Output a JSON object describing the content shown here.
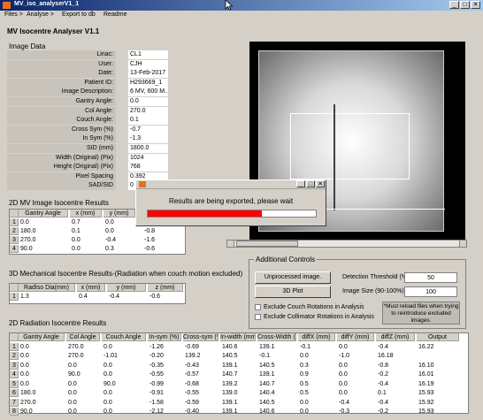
{
  "window": {
    "title": "MV_iso_analyserV1_1"
  },
  "controls": {
    "minimize": "_",
    "maximize": "□",
    "close": "✕"
  },
  "menu": [
    "Files >",
    "Analyse >",
    "Export to db",
    "Readme"
  ],
  "app_title": "MV Isocentre Analyser V1.1",
  "image_data": {
    "heading": "Image Data",
    "rows": [
      {
        "label": "Linac:",
        "value": "CL1"
      },
      {
        "label": "User:",
        "value": "CJH"
      },
      {
        "label": "Date:",
        "value": "13-Feb-2017"
      },
      {
        "label": "Patient ID:",
        "value": "H293669_1"
      },
      {
        "label": "Image Description:",
        "value": "6 MV, 600 M..."
      },
      {
        "label": "Gantry Angle:",
        "value": "0.0"
      },
      {
        "label": "Col Angle:",
        "value": "270.0"
      },
      {
        "label": "Couch Angle:",
        "value": "0.1"
      },
      {
        "label": "Cross Sym (%)",
        "value": "-0.7"
      },
      {
        "label": "In Sym (%)",
        "value": "-1.3"
      },
      {
        "label": "SID (mm)",
        "value": "1800.0"
      },
      {
        "label": "Width (Original) (Pix)",
        "value": "1024"
      },
      {
        "label": "Height (Original) (Pix)",
        "value": "768"
      },
      {
        "label": "Pixel Spacing",
        "value": "0.392"
      },
      {
        "label": "SAD/SID",
        "value": "0"
      }
    ]
  },
  "mv_results": {
    "heading": "2D MV Image Isocentre Results",
    "columns": [
      "Gantry Angle",
      "x (mm)",
      "y (mm)"
    ],
    "rows": [
      {
        "n": "1",
        "cells": [
          "0.0",
          "0.7",
          "0.0"
        ],
        "extra": ""
      },
      {
        "n": "2",
        "cells": [
          "180.0",
          "0.1",
          "0.0"
        ],
        "extra": "-0.8"
      },
      {
        "n": "3",
        "cells": [
          "270.0",
          "0.0",
          "-0.4"
        ],
        "extra": "-1.6"
      },
      {
        "n": "4",
        "cells": [
          "90.0",
          "0.0",
          "0.3"
        ],
        "extra": "-0.6"
      }
    ]
  },
  "mech_results": {
    "heading": "3D Mechanical Isocentre Results-(Radiation when couch motion excluded)",
    "columns": [
      "RadIso Dia(mm)",
      "x (mm)",
      "y (mm)",
      "z (mm)"
    ],
    "rows": [
      {
        "n": "1",
        "cells": [
          "1.3",
          "0.4",
          "-0.4",
          "-0.6"
        ]
      }
    ]
  },
  "additional_controls": {
    "heading": "Additional Controls",
    "unprocessed_btn": "Unprocessed image.",
    "plot_btn": "3D Plot",
    "detection_label": "Detection Threshold (%)",
    "detection_value": "50",
    "image_size_label": "Image Size (90-100%)",
    "image_size_value": "100",
    "exclude_couch": "Exclude Couch Rotations in Analysis",
    "exclude_collimator": "Exclude Collimator Rotations in Analysis",
    "note": "*Must reload files when trying to reintroduce excluded images."
  },
  "rad_results": {
    "heading": "2D Radiation Isocentre Results",
    "columns": [
      "Gantry Angle",
      "Col Angle",
      "Couch Angle",
      "In-sym (%)",
      "Cross-sym (%)",
      "In-width (mm)",
      "Cross-Width (mm)",
      "diffX (mm)",
      "diffY (mm)",
      "diffZ (mm)",
      "Output"
    ],
    "rows": [
      {
        "n": "1",
        "cells": [
          "0.0",
          "270.0",
          "0.0",
          "-1.26",
          "-0.69",
          "140.6",
          "139.1",
          "-0.1",
          "0.0",
          "-0.4",
          "16.22"
        ]
      },
      {
        "n": "2",
        "cells": [
          "0.0",
          "270.0",
          "-1.01",
          "-0.20",
          "139.2",
          "140.5",
          "-0.1",
          "0.0",
          "-1.0",
          "16.18"
        ]
      },
      {
        "n": "3",
        "cells": [
          "0.0",
          "0.0",
          "0.0",
          "-0.35",
          "-0.43",
          "139.1",
          "140.5",
          "0.3",
          "0.0",
          "-0.8",
          "16.10"
        ]
      },
      {
        "n": "4",
        "cells": [
          "0.0",
          "90.0",
          "0.0",
          "-0.55",
          "-0.57",
          "140.7",
          "139.1",
          "0.9",
          "0.0",
          "-0.2",
          "16.01"
        ]
      },
      {
        "n": "5",
        "cells": [
          "0.0",
          "0.0",
          "90.0",
          "-0.99",
          "-0.68",
          "139.2",
          "140.7",
          "0.5",
          "0.0",
          "-0.4",
          "16.19"
        ]
      },
      {
        "n": "6",
        "cells": [
          "180.0",
          "0.0",
          "0.0",
          "-0.91",
          "-0.55",
          "139.0",
          "140.4",
          "0.5",
          "0.0",
          "0.1",
          "15.93"
        ]
      },
      {
        "n": "7",
        "cells": [
          "270.0",
          "0.0",
          "0.0",
          "-1.58",
          "-0.59",
          "139.1",
          "140.5",
          "0.0",
          "-0.4",
          "-0.4",
          "15.92"
        ]
      },
      {
        "n": "8",
        "cells": [
          "90.0",
          "0.0",
          "0.0",
          "-2.12",
          "-0.40",
          "139.1",
          "140.6",
          "0.0",
          "-0.3",
          "-0.2",
          "15.93"
        ]
      }
    ]
  },
  "dialog": {
    "message": "Results are being exported, please wait",
    "progress": 0.68
  }
}
